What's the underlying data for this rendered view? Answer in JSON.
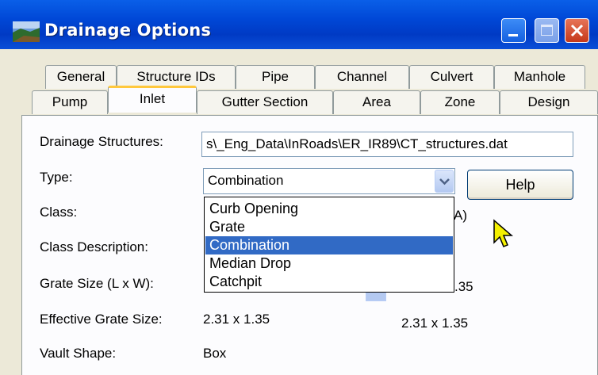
{
  "window": {
    "title": "Drainage Options",
    "colors": {
      "title_bar": "#0047d6",
      "selection": "#316ac5",
      "active_tab_accent": "#ffc83c"
    }
  },
  "tabs_row1": [
    "General",
    "Structure IDs",
    "Pipe",
    "Channel",
    "Culvert",
    "Manhole"
  ],
  "tabs_row2": [
    "Pump",
    "Inlet",
    "Gutter Section",
    "Area",
    "Zone",
    "Design"
  ],
  "active_tab": "Inlet",
  "form": {
    "drainage_structures_label": "Drainage Structures:",
    "drainage_structures_value": "s\\_Eng_Data\\InRoads\\ER_IR89\\CT_structures.dat",
    "type_label": "Type:",
    "type_value": "Combination",
    "class_label": "Class:",
    "class_value_partial": "A)",
    "class_description_label": "Class Description:",
    "grate_size_label": "Grate Size (L x W):",
    "grate_size_right_partial": ".35",
    "effective_grate_size_label": "Effective Grate Size:",
    "effective_grate_size_value": "2.31 x 1.35",
    "effective_grate_size_value_right": "2.31 x 1.35",
    "vault_shape_label": "Vault Shape:",
    "vault_shape_value": "Box"
  },
  "help_button": "Help",
  "type_dropdown": {
    "options": [
      "Curb Opening",
      "Grate",
      "Combination",
      "Median Drop",
      "Catchpit"
    ],
    "selected": "Combination"
  },
  "icons": [
    "app-icon",
    "minimize-icon",
    "maximize-icon",
    "close-icon",
    "chevron-down-icon",
    "mouse-cursor-icon"
  ]
}
